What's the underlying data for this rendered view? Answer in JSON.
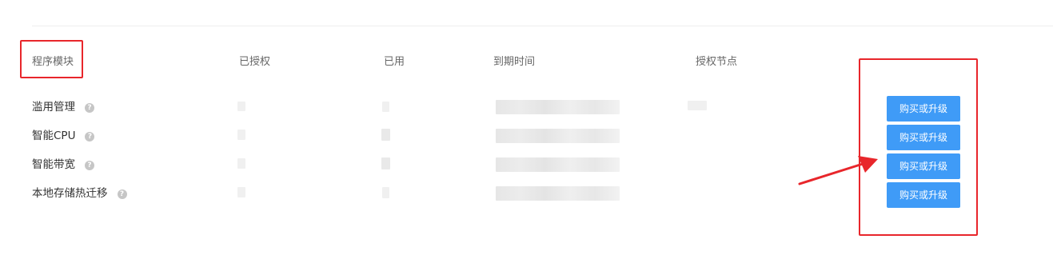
{
  "columns": {
    "module": "程序模块",
    "authorized": "已授权",
    "used": "已用",
    "expiry": "到期时间",
    "nodes": "授权节点"
  },
  "rows": [
    {
      "name": "滥用管理",
      "help_icon": "question-circle-icon",
      "action": "购买或升级"
    },
    {
      "name": "智能CPU",
      "help_icon": "question-circle-icon",
      "action": "购买或升级"
    },
    {
      "name": "智能带宽",
      "help_icon": "question-circle-icon",
      "action": "购买或升级"
    },
    {
      "name": "本地存储热迁移",
      "help_icon": "question-circle-icon",
      "action": "购买或升级"
    }
  ],
  "colors": {
    "button": "#3f9bf7",
    "annotation": "#e8262b"
  }
}
